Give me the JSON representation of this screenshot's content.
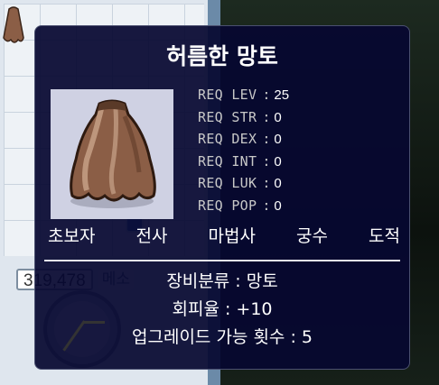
{
  "background": {
    "meso_value": "319,478",
    "meso_label": "메소"
  },
  "tooltip": {
    "item_name": "허름한 망토",
    "requirements": [
      {
        "label": "REQ LEV",
        "value": "25"
      },
      {
        "label": "REQ STR",
        "value": "0"
      },
      {
        "label": "REQ DEX",
        "value": "0"
      },
      {
        "label": "REQ INT",
        "value": "0"
      },
      {
        "label": "REQ LUK",
        "value": "0"
      },
      {
        "label": "REQ POP",
        "value": "0"
      }
    ],
    "jobs": [
      "초보자",
      "전사",
      "마법사",
      "궁수",
      "도적"
    ],
    "stats": [
      "장비분류 : 망토",
      "회피율 : +10",
      "업그레이드 가능 횟수 : 5"
    ]
  },
  "colors": {
    "tooltip_bg": "#06082f",
    "text": "#ffffff",
    "req_label": "#c8c8c8",
    "cape_brown": "#8b5e46"
  },
  "icons": [
    "cape-item-icon",
    "cape-slot-icon",
    "clock-icon"
  ]
}
